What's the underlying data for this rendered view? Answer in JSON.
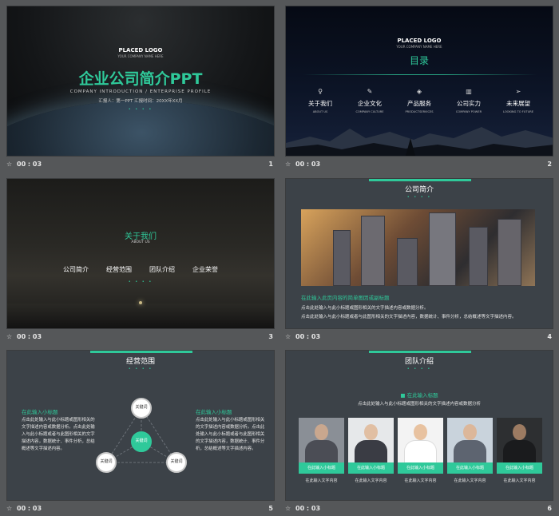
{
  "colors": {
    "accent": "#2fc99a",
    "canvas": "#555759",
    "slide_dark": "#3c4248"
  },
  "slides": [
    {
      "number": "1",
      "time": "00 : 03",
      "logo": "PLACED LOGO",
      "logo_sub": "YOUR COMPANY NAME HERE",
      "title": "企业公司简介PPT",
      "subtitle_en": "COMPANY INTRODUCTION / ENTERPRISE  PROFILE",
      "reporter": "汇报人：第一PPT    汇报时间：20XX年XX月",
      "dots": "• • • •"
    },
    {
      "number": "2",
      "time": "00 : 03",
      "logo": "PLACED LOGO",
      "logo_sub": "YOUR COMPANY NAME HERE",
      "title": "目录",
      "items": [
        {
          "icon": "lightbulb-icon",
          "glyph": "♀",
          "label": "关于我们",
          "en": "ABOUT  US"
        },
        {
          "icon": "pen-icon",
          "glyph": "✎",
          "label": "企业文化",
          "en": "COMPANY  CULTURE"
        },
        {
          "icon": "location-icon",
          "glyph": "◈",
          "label": "产品服务",
          "en": "PRODUCTSERVICES"
        },
        {
          "icon": "bar-chart-icon",
          "glyph": "▥",
          "label": "公司实力",
          "en": "COMPANY  POWER"
        },
        {
          "icon": "send-icon",
          "glyph": "➢",
          "label": "未来展望",
          "en": "LOOKING  TO  FUTURE"
        }
      ]
    },
    {
      "number": "3",
      "time": "00 : 03",
      "title": "关于我们",
      "title_en": "ABOUT  US",
      "links": [
        "公司简介",
        "经营范围",
        "团队介绍",
        "企业荣誉"
      ],
      "dots": "• • • •"
    },
    {
      "number": "4",
      "time": "00 : 03",
      "title": "公司简介",
      "dots": "• • • •",
      "highlight": "在此输入此页内容的简单图因或副标题",
      "lines": [
        "点击此处输入与此小标题或图形相关的文字描述内容或数据分析。",
        "点击此处输入与此小标题或者与此图形相关的文字描述内容，数据统计、事件分析，总结概述等文字描述内容。"
      ]
    },
    {
      "number": "5",
      "time": "00 : 03",
      "title": "经营范围",
      "dots": "• • • •",
      "left_title": "在此输入小标题",
      "right_title": "在此输入小标题",
      "left_text": "点击此处输入与此小标题或图形相关的文字描述内容或数据分析。点击此处输入与此小标题或者与此图形相关的文字描述内容，数据统计、事件分析，总结概述等文字描述内容。",
      "right_text": "点击此处输入与此小标题或图形相关的文字描述内容或数据分析。点击此处输入与此小标题或者与此图形相关的文字描述内容，数据统计、事件分析，总结概述等文字描述内容。",
      "nodes": {
        "top": "关键词",
        "center": "关键词",
        "left": "关键词",
        "right": "关键词"
      }
    },
    {
      "number": "6",
      "time": "00 : 03",
      "title": "团队介绍",
      "dots": "• • • •",
      "header": "■ 在此输入标题",
      "desc": "点击此处输入与此小标题或图形相关的文字描述内容或数据分析",
      "members": [
        {
          "button": "在此输入小标题",
          "caption": "在此输入文字内容"
        },
        {
          "button": "在此输入小标题",
          "caption": "在此输入文字内容"
        },
        {
          "button": "在此输入小标题",
          "caption": "在此输入文字内容"
        },
        {
          "button": "在此输入小标题",
          "caption": "在此输入文字内容"
        },
        {
          "button": "在此输入小标题",
          "caption": "在此输入文字内容"
        }
      ]
    }
  ]
}
